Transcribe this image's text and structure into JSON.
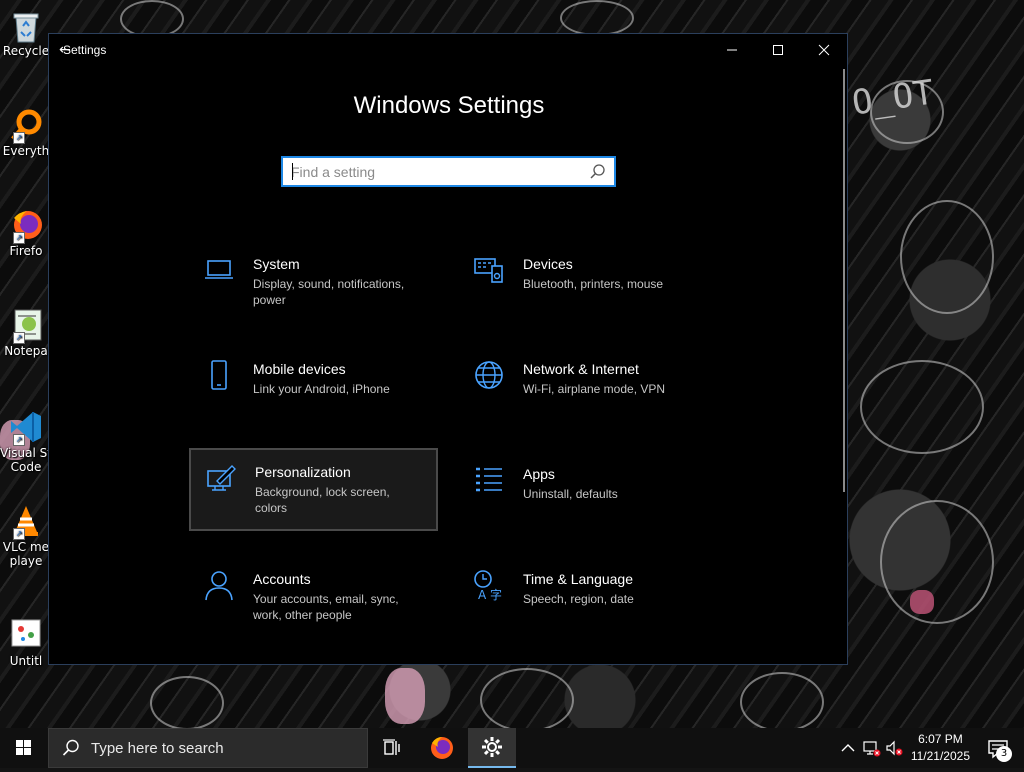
{
  "desktop": {
    "icons": [
      {
        "label": "Recycle",
        "icon": "recycle-bin-icon"
      },
      {
        "label": "Everyth",
        "icon": "everything-search-icon"
      },
      {
        "label": "Firefo",
        "icon": "firefox-icon"
      },
      {
        "label": "Notepa",
        "icon": "notepad-icon"
      },
      {
        "label": "Visual St",
        "label2": "Code",
        "icon": "vscode-icon"
      },
      {
        "label": "VLC me",
        "label2": "playe",
        "icon": "vlc-icon"
      },
      {
        "label": "Untitl",
        "icon": "paint-file-icon"
      }
    ],
    "wallpaper_text": "O_OT"
  },
  "window": {
    "title": "Settings",
    "back_glyph": "←",
    "controls": {
      "minimize": "—",
      "maximize": "☐",
      "close": "✕"
    },
    "heading": "Windows Settings",
    "search": {
      "placeholder": "Find a setting",
      "value": ""
    },
    "accent": "#1e88e5",
    "tiles": [
      {
        "name": "System",
        "desc": "Display, sound, notifications, power",
        "icon": "laptop-icon"
      },
      {
        "name": "Devices",
        "desc": "Bluetooth, printers, mouse",
        "icon": "devices-icon"
      },
      {
        "name": "Mobile devices",
        "desc": "Link your Android, iPhone",
        "icon": "phone-icon"
      },
      {
        "name": "Network & Internet",
        "desc": "Wi-Fi, airplane mode, VPN",
        "icon": "globe-icon"
      },
      {
        "name": "Personalization",
        "desc": "Background, lock screen, colors",
        "icon": "paint-brush-icon",
        "selected": true
      },
      {
        "name": "Apps",
        "desc": "Uninstall, defaults",
        "icon": "apps-list-icon"
      },
      {
        "name": "Accounts",
        "desc": "Your accounts, email, sync, work, other people",
        "icon": "person-icon"
      },
      {
        "name": "Time & Language",
        "desc": "Speech, region, date",
        "icon": "time-language-icon"
      }
    ]
  },
  "taskbar": {
    "search_placeholder": "Type here to search",
    "time": "6:07 PM",
    "date": "11/21/2025",
    "notification_count": "3"
  }
}
